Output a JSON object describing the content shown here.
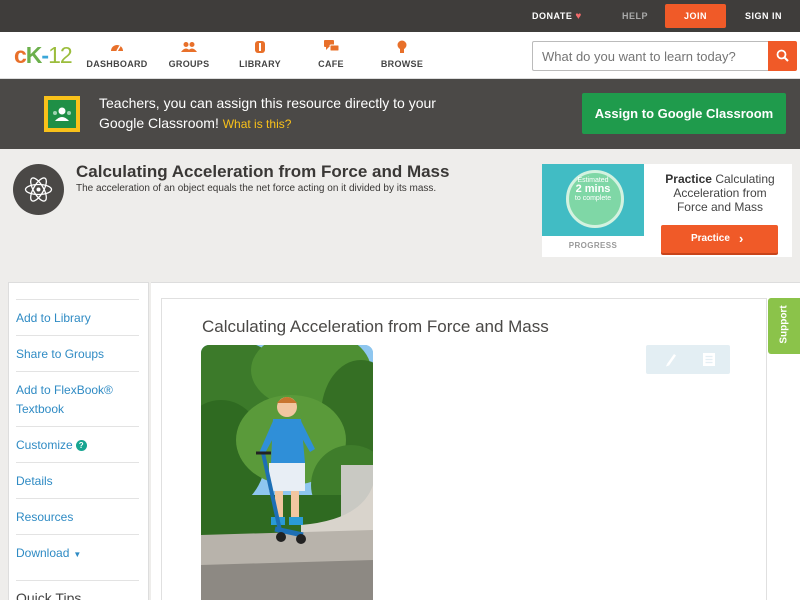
{
  "topbar": {
    "donate": "DONATE",
    "help": "HELP",
    "join": "JOIN",
    "signin": "SIGN IN"
  },
  "header": {
    "logo": {
      "c": "c",
      "k": "K",
      "dash": "-",
      "num": "12"
    },
    "nav": [
      {
        "label": "DASHBOARD",
        "icon": "dashboard-icon"
      },
      {
        "label": "GROUPS",
        "icon": "groups-icon"
      },
      {
        "label": "LIBRARY",
        "icon": "library-icon"
      },
      {
        "label": "CAFE",
        "icon": "cafe-icon"
      },
      {
        "label": "BROWSE",
        "icon": "browse-icon"
      }
    ],
    "search": {
      "placeholder": "What do you want to learn today?"
    }
  },
  "banner": {
    "text": "Teachers, you can assign this resource directly to your Google Classroom!",
    "what": "What is this?",
    "button": "Assign to Google Classroom"
  },
  "concept": {
    "title": "Calculating Acceleration from Force and Mass",
    "subtitle": "The acceleration of an object equals the net force acting on it divided by its mass."
  },
  "practice": {
    "estimated": "Estimated",
    "mins": "2 mins",
    "to_complete": "to complete",
    "progress_label": "PROGRESS",
    "title_bold": "Practice",
    "title_rest": "Calculating Acceleration from Force and Mass",
    "button": "Practice"
  },
  "sidebar": {
    "items": [
      {
        "label": "Add to Library"
      },
      {
        "label": "Share to Groups"
      },
      {
        "label": "Add to FlexBook® Textbook"
      },
      {
        "label": "Customize"
      },
      {
        "label": "Details"
      },
      {
        "label": "Resources"
      },
      {
        "label": "Download"
      }
    ],
    "quick_tips": "Quick Tips"
  },
  "main": {
    "title": "Calculating Acceleration from Force and Mass"
  },
  "support": "Support",
  "colors": {
    "accent": "#f05a28",
    "green": "#1f9b4c",
    "link": "#2f8bc4",
    "support": "#8bc34a"
  }
}
